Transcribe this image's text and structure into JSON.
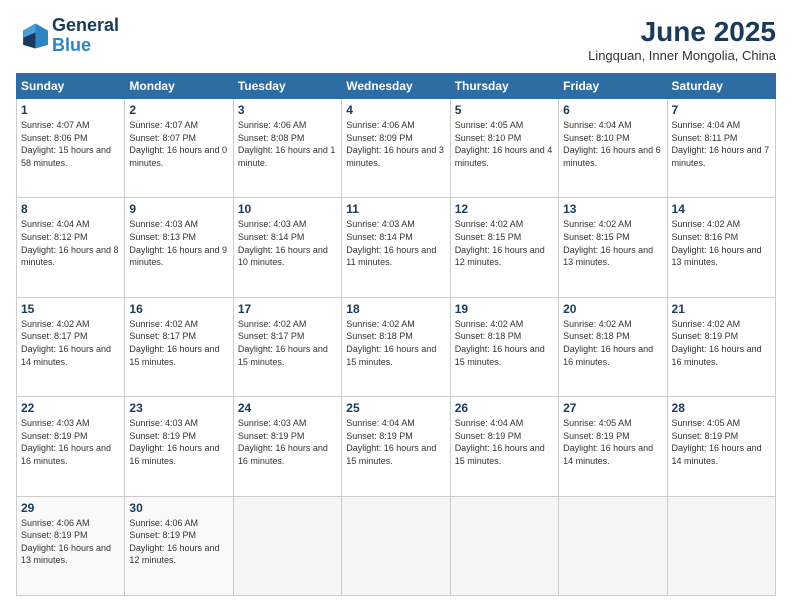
{
  "logo": {
    "line1": "General",
    "line2": "Blue"
  },
  "title": "June 2025",
  "subtitle": "Lingquan, Inner Mongolia, China",
  "days_header": [
    "Sunday",
    "Monday",
    "Tuesday",
    "Wednesday",
    "Thursday",
    "Friday",
    "Saturday"
  ],
  "weeks": [
    [
      {
        "num": "1",
        "sunrise": "Sunrise: 4:07 AM",
        "sunset": "Sunset: 8:06 PM",
        "daylight": "Daylight: 15 hours and 58 minutes."
      },
      {
        "num": "2",
        "sunrise": "Sunrise: 4:07 AM",
        "sunset": "Sunset: 8:07 PM",
        "daylight": "Daylight: 16 hours and 0 minutes."
      },
      {
        "num": "3",
        "sunrise": "Sunrise: 4:06 AM",
        "sunset": "Sunset: 8:08 PM",
        "daylight": "Daylight: 16 hours and 1 minute."
      },
      {
        "num": "4",
        "sunrise": "Sunrise: 4:06 AM",
        "sunset": "Sunset: 8:09 PM",
        "daylight": "Daylight: 16 hours and 3 minutes."
      },
      {
        "num": "5",
        "sunrise": "Sunrise: 4:05 AM",
        "sunset": "Sunset: 8:10 PM",
        "daylight": "Daylight: 16 hours and 4 minutes."
      },
      {
        "num": "6",
        "sunrise": "Sunrise: 4:04 AM",
        "sunset": "Sunset: 8:10 PM",
        "daylight": "Daylight: 16 hours and 6 minutes."
      },
      {
        "num": "7",
        "sunrise": "Sunrise: 4:04 AM",
        "sunset": "Sunset: 8:11 PM",
        "daylight": "Daylight: 16 hours and 7 minutes."
      }
    ],
    [
      {
        "num": "8",
        "sunrise": "Sunrise: 4:04 AM",
        "sunset": "Sunset: 8:12 PM",
        "daylight": "Daylight: 16 hours and 8 minutes."
      },
      {
        "num": "9",
        "sunrise": "Sunrise: 4:03 AM",
        "sunset": "Sunset: 8:13 PM",
        "daylight": "Daylight: 16 hours and 9 minutes."
      },
      {
        "num": "10",
        "sunrise": "Sunrise: 4:03 AM",
        "sunset": "Sunset: 8:14 PM",
        "daylight": "Daylight: 16 hours and 10 minutes."
      },
      {
        "num": "11",
        "sunrise": "Sunrise: 4:03 AM",
        "sunset": "Sunset: 8:14 PM",
        "daylight": "Daylight: 16 hours and 11 minutes."
      },
      {
        "num": "12",
        "sunrise": "Sunrise: 4:02 AM",
        "sunset": "Sunset: 8:15 PM",
        "daylight": "Daylight: 16 hours and 12 minutes."
      },
      {
        "num": "13",
        "sunrise": "Sunrise: 4:02 AM",
        "sunset": "Sunset: 8:15 PM",
        "daylight": "Daylight: 16 hours and 13 minutes."
      },
      {
        "num": "14",
        "sunrise": "Sunrise: 4:02 AM",
        "sunset": "Sunset: 8:16 PM",
        "daylight": "Daylight: 16 hours and 13 minutes."
      }
    ],
    [
      {
        "num": "15",
        "sunrise": "Sunrise: 4:02 AM",
        "sunset": "Sunset: 8:17 PM",
        "daylight": "Daylight: 16 hours and 14 minutes."
      },
      {
        "num": "16",
        "sunrise": "Sunrise: 4:02 AM",
        "sunset": "Sunset: 8:17 PM",
        "daylight": "Daylight: 16 hours and 15 minutes."
      },
      {
        "num": "17",
        "sunrise": "Sunrise: 4:02 AM",
        "sunset": "Sunset: 8:17 PM",
        "daylight": "Daylight: 16 hours and 15 minutes."
      },
      {
        "num": "18",
        "sunrise": "Sunrise: 4:02 AM",
        "sunset": "Sunset: 8:18 PM",
        "daylight": "Daylight: 16 hours and 15 minutes."
      },
      {
        "num": "19",
        "sunrise": "Sunrise: 4:02 AM",
        "sunset": "Sunset: 8:18 PM",
        "daylight": "Daylight: 16 hours and 15 minutes."
      },
      {
        "num": "20",
        "sunrise": "Sunrise: 4:02 AM",
        "sunset": "Sunset: 8:18 PM",
        "daylight": "Daylight: 16 hours and 16 minutes."
      },
      {
        "num": "21",
        "sunrise": "Sunrise: 4:02 AM",
        "sunset": "Sunset: 8:19 PM",
        "daylight": "Daylight: 16 hours and 16 minutes."
      }
    ],
    [
      {
        "num": "22",
        "sunrise": "Sunrise: 4:03 AM",
        "sunset": "Sunset: 8:19 PM",
        "daylight": "Daylight: 16 hours and 16 minutes."
      },
      {
        "num": "23",
        "sunrise": "Sunrise: 4:03 AM",
        "sunset": "Sunset: 8:19 PM",
        "daylight": "Daylight: 16 hours and 16 minutes."
      },
      {
        "num": "24",
        "sunrise": "Sunrise: 4:03 AM",
        "sunset": "Sunset: 8:19 PM",
        "daylight": "Daylight: 16 hours and 16 minutes."
      },
      {
        "num": "25",
        "sunrise": "Sunrise: 4:04 AM",
        "sunset": "Sunset: 8:19 PM",
        "daylight": "Daylight: 16 hours and 15 minutes."
      },
      {
        "num": "26",
        "sunrise": "Sunrise: 4:04 AM",
        "sunset": "Sunset: 8:19 PM",
        "daylight": "Daylight: 16 hours and 15 minutes."
      },
      {
        "num": "27",
        "sunrise": "Sunrise: 4:05 AM",
        "sunset": "Sunset: 8:19 PM",
        "daylight": "Daylight: 16 hours and 14 minutes."
      },
      {
        "num": "28",
        "sunrise": "Sunrise: 4:05 AM",
        "sunset": "Sunset: 8:19 PM",
        "daylight": "Daylight: 16 hours and 14 minutes."
      }
    ],
    [
      {
        "num": "29",
        "sunrise": "Sunrise: 4:06 AM",
        "sunset": "Sunset: 8:19 PM",
        "daylight": "Daylight: 16 hours and 13 minutes."
      },
      {
        "num": "30",
        "sunrise": "Sunrise: 4:06 AM",
        "sunset": "Sunset: 8:19 PM",
        "daylight": "Daylight: 16 hours and 12 minutes."
      },
      null,
      null,
      null,
      null,
      null
    ]
  ]
}
